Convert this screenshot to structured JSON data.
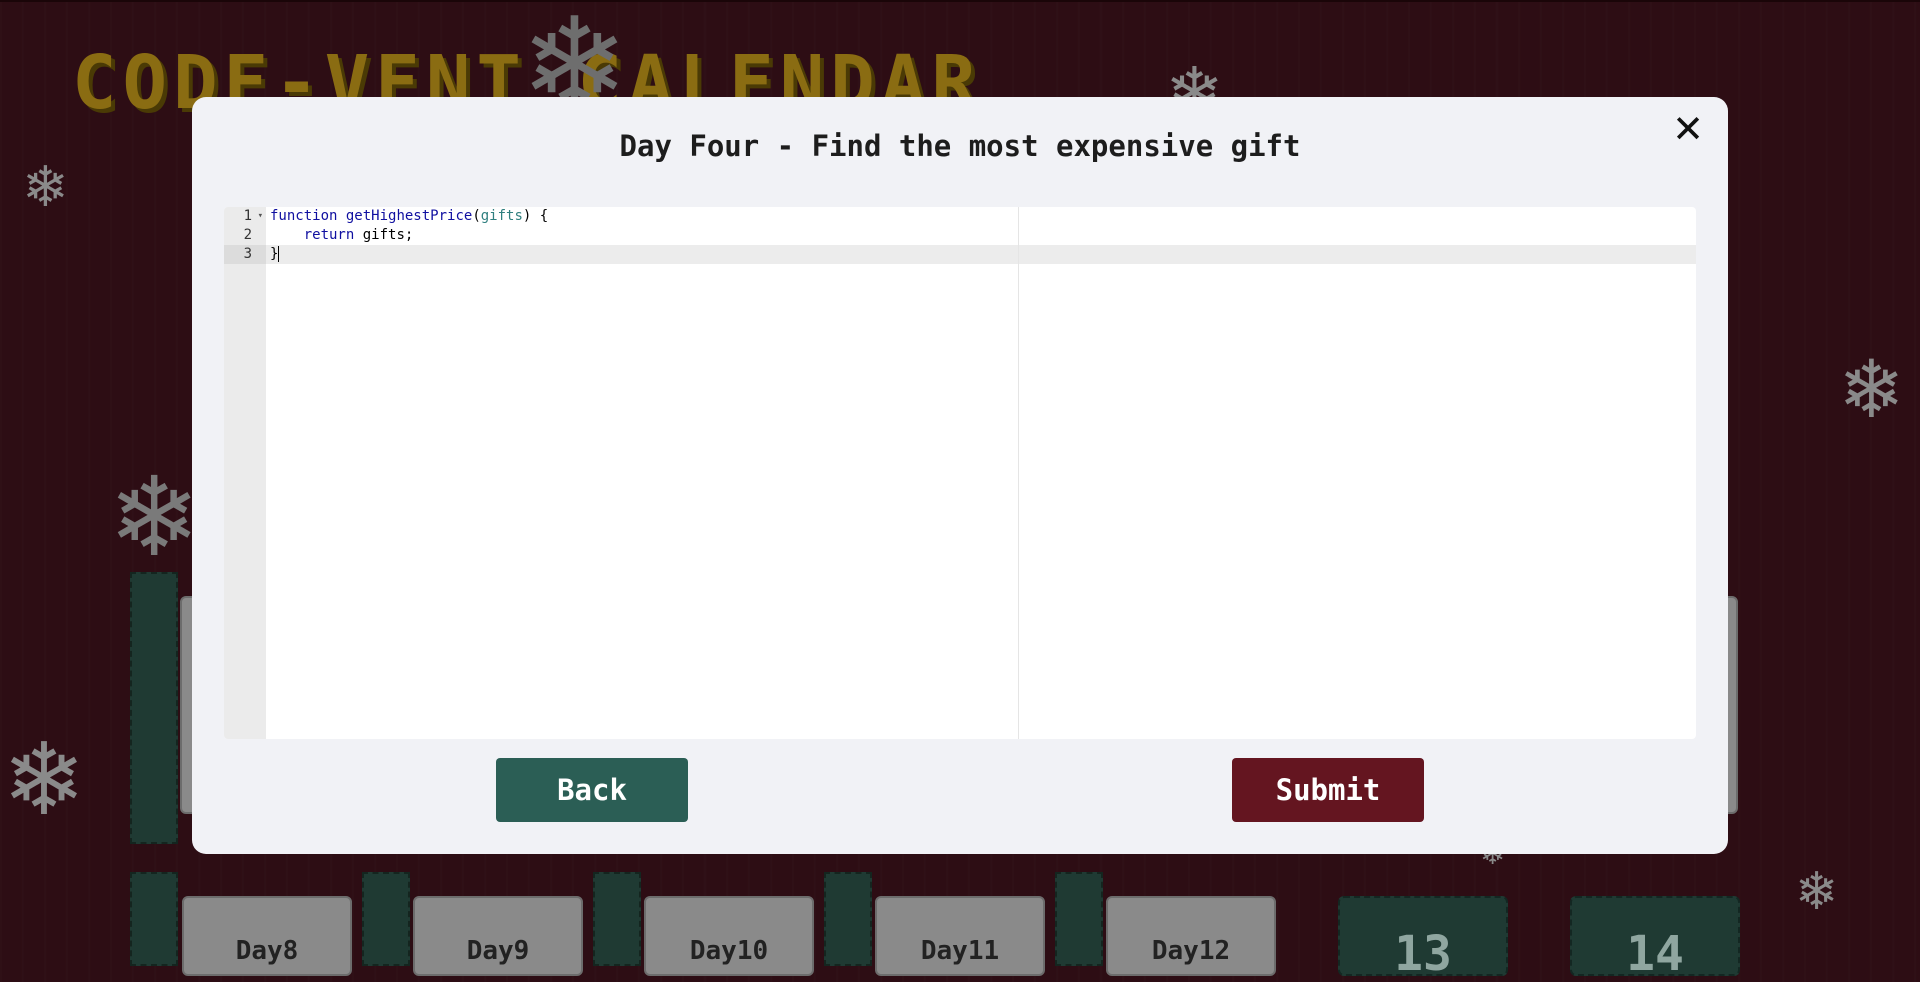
{
  "background": {
    "calendar_title": "CODE-VENT CALENDAR",
    "day_tiles": [
      "Day8",
      "Day9",
      "Day10",
      "Day11",
      "Day12"
    ],
    "locked_tiles": [
      "13",
      "14"
    ]
  },
  "modal": {
    "title": "Day Four - Find the most expensive gift",
    "close_label": "✕",
    "editor": {
      "line_numbers": [
        "1",
        "2",
        "3"
      ],
      "lines": [
        {
          "keyword": "function",
          "name": "getHighestPrice",
          "param": "gifts",
          "rest": " {"
        },
        {
          "indent": "    ",
          "keyword": "return",
          "rest": " gifts;"
        },
        {
          "rest": "}"
        }
      ]
    },
    "back_label": "Back",
    "submit_label": "Submit"
  },
  "colors": {
    "page_bg": "#2d0d14",
    "back_button": "#2b5e55",
    "submit_button": "#641520",
    "title_gold": "#8a6c12"
  }
}
